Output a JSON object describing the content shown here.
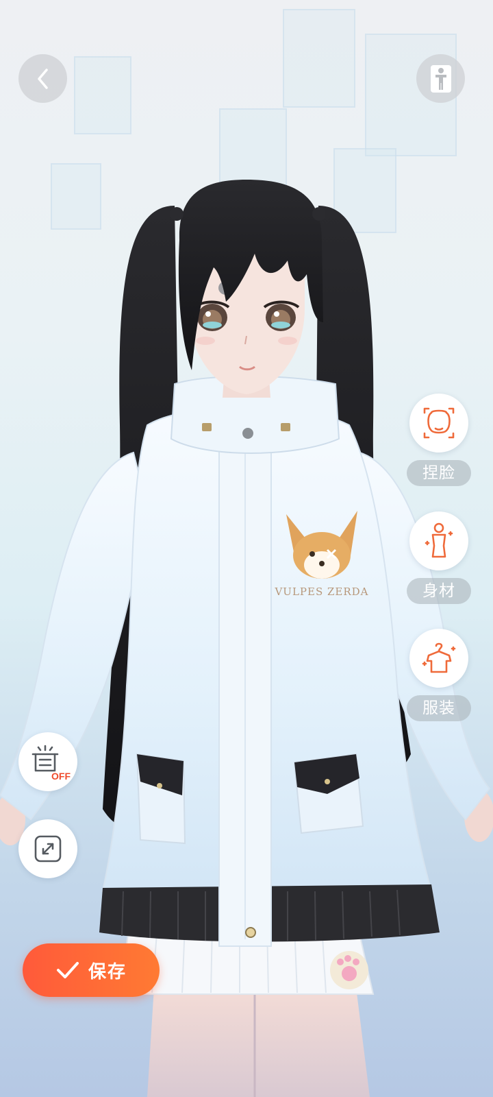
{
  "header": {
    "back_icon": "chevron-left-icon",
    "pose_icon": "body-pose-icon"
  },
  "side_menu": {
    "items": [
      {
        "label": "捏脸",
        "icon": "face-shape-icon"
      },
      {
        "label": "身材",
        "icon": "body-shape-icon"
      },
      {
        "label": "服装",
        "icon": "clothing-hanger-icon"
      }
    ]
  },
  "tools": {
    "background_toggle": {
      "icon": "display-stand-icon",
      "state_text": "OFF"
    },
    "fullscreen": {
      "icon": "expand-icon"
    }
  },
  "footer": {
    "save_label": "保存",
    "save_icon": "checkmark-icon"
  },
  "avatar": {
    "logo_text": "VULPES ZERDA"
  },
  "colors": {
    "accent": "#ff5a3a",
    "accent_end": "#ff7a33",
    "icon_orange": "#ef6a3a",
    "label_bg": "#a8b0b6"
  }
}
